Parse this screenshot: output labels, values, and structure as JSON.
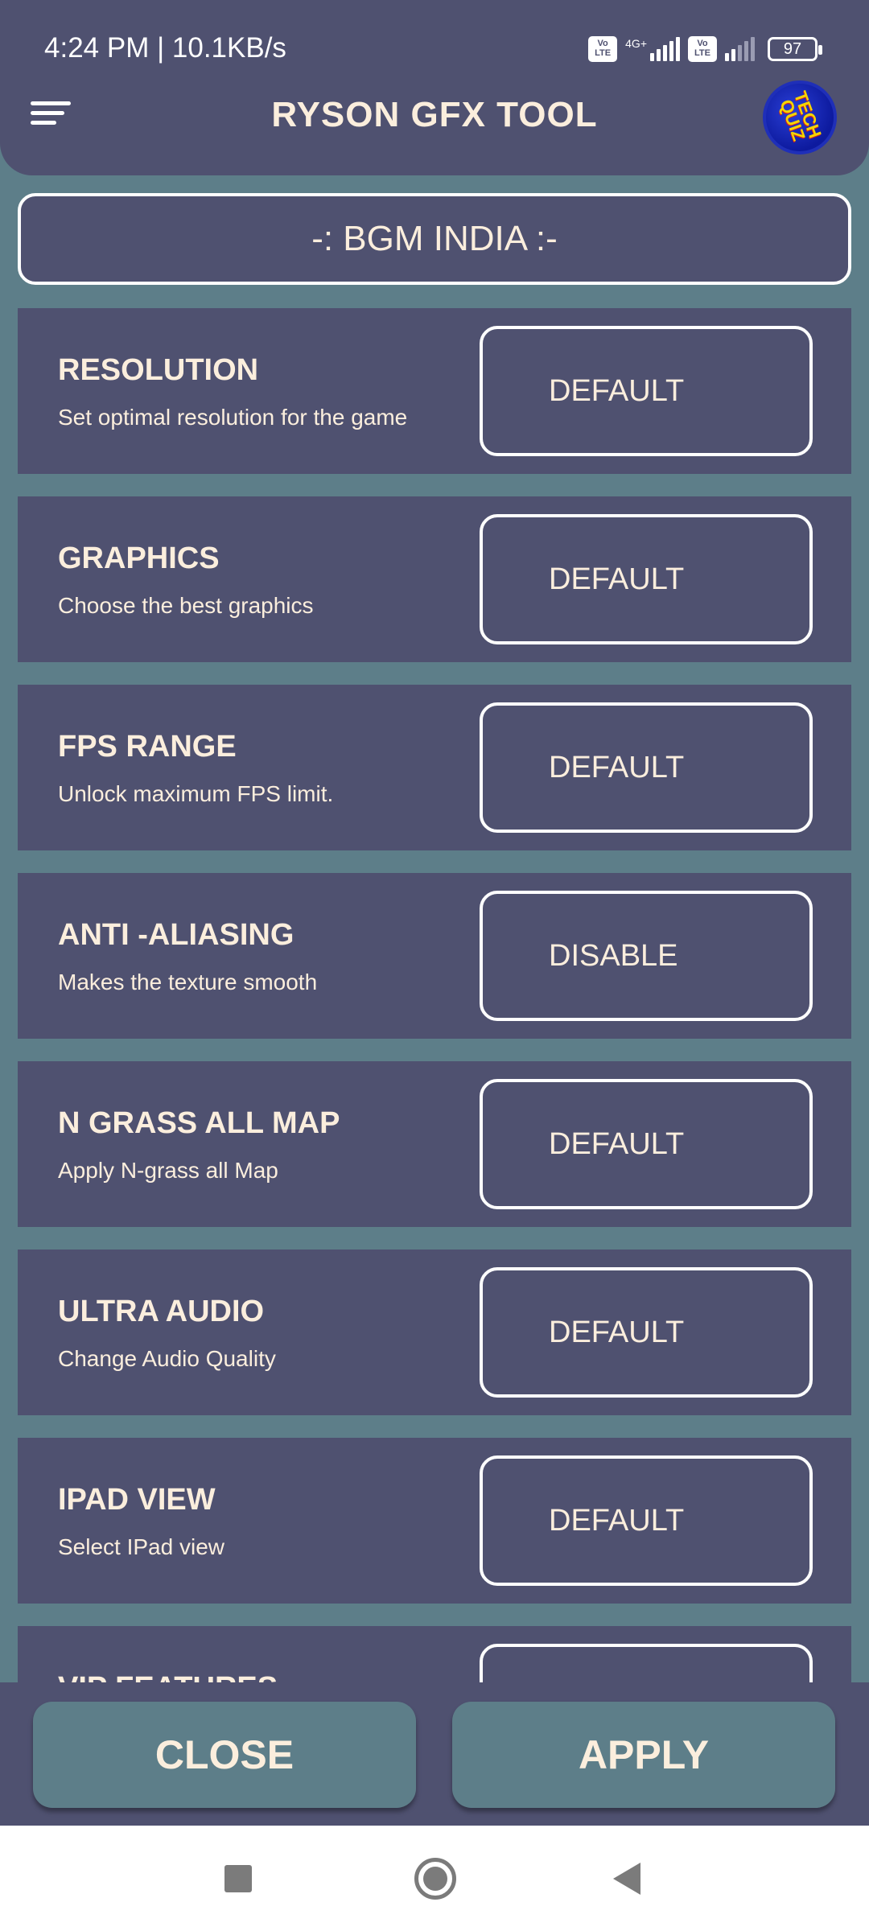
{
  "status_bar": {
    "time": "4:24 PM | 10.1KB/s",
    "volte_label": "Vo LTE",
    "network_type": "4G+",
    "battery": "97"
  },
  "header": {
    "title": "RYSON GFX TOOL",
    "logo_text": "TECH QUIZ"
  },
  "server": {
    "label": "-: BGM INDIA :-"
  },
  "settings": [
    {
      "title": "RESOLUTION",
      "description": "Set optimal resolution for the game",
      "value": "DEFAULT"
    },
    {
      "title": "GRAPHICS",
      "description": "Choose the best graphics",
      "value": "DEFAULT"
    },
    {
      "title": "FPS RANGE",
      "description": "Unlock maximum FPS limit.",
      "value": "DEFAULT"
    },
    {
      "title": "ANTI -ALIASING",
      "description": "Makes the texture smooth",
      "value": "DISABLE"
    },
    {
      "title": "N GRASS ALL MAP",
      "description": "Apply N-grass all Map",
      "value": "DEFAULT"
    },
    {
      "title": "ULTRA AUDIO",
      "description": "Change Audio Quality",
      "value": "DEFAULT"
    },
    {
      "title": "IPAD VIEW",
      "description": "Select IPad view",
      "value": "DEFAULT"
    },
    {
      "title": "VIP FEATURES",
      "description": "",
      "value": ""
    }
  ],
  "actions": {
    "close_label": "CLOSE",
    "apply_label": "APPLY"
  },
  "colors": {
    "background": "#5d7e89",
    "panel": "#4f5170",
    "text": "#fbeedd"
  }
}
